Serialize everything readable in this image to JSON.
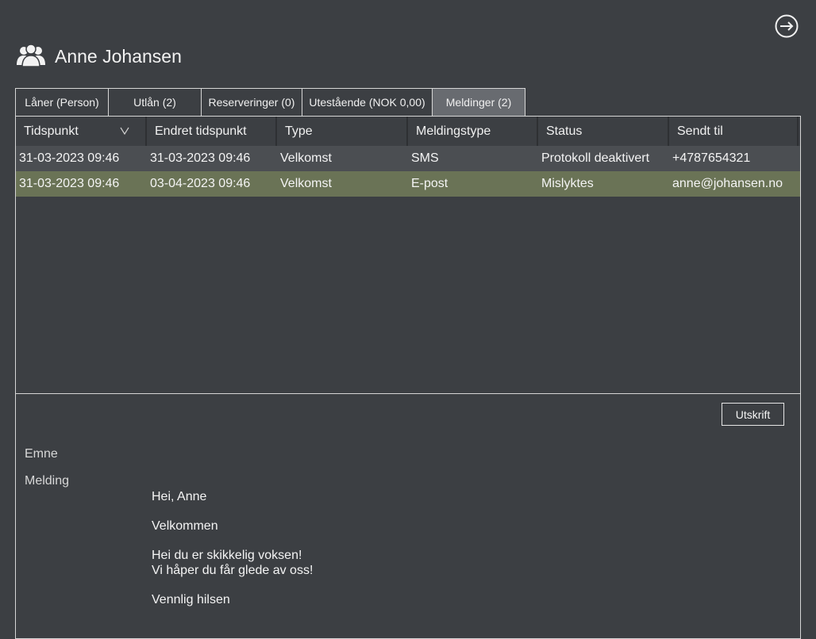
{
  "header": {
    "person_name": "Anne Johansen",
    "icon": "people-icon",
    "logout_icon": "arrow-right-circle-icon"
  },
  "tabs": [
    {
      "label": "Låner (Person)"
    },
    {
      "label": "Utlån (2)"
    },
    {
      "label": "Reserveringer (0)"
    },
    {
      "label": "Utestående (NOK 0,00)"
    },
    {
      "label": "Meldinger (2)",
      "active": true
    }
  ],
  "grid": {
    "columns": [
      {
        "label": "Tidspunkt",
        "sorted": "descending"
      },
      {
        "label": "Endret tidspunkt"
      },
      {
        "label": "Type"
      },
      {
        "label": "Meldingstype"
      },
      {
        "label": "Status"
      },
      {
        "label": "Sendt til"
      }
    ],
    "rows": [
      {
        "cells": [
          "31-03-2023 09:46",
          "31-03-2023 09:46",
          "Velkomst",
          "SMS",
          "Protokoll deaktivert",
          "+4787654321"
        ]
      },
      {
        "cells": [
          "31-03-2023 09:46",
          "03-04-2023 09:46",
          "Velkomst",
          "E-post",
          "Mislyktes",
          "anne@johansen.no"
        ],
        "selected": true
      }
    ]
  },
  "detail": {
    "print_label": "Utskrift",
    "subject_label": "Emne",
    "message_label": "Melding",
    "message_lines": {
      "greeting": "Hei, Anne",
      "welcome": "Velkommen",
      "line1": "Hei du er skikkelig voksen!",
      "line2": "Vi håper du får glede av oss!",
      "closing": "Vennlig hilsen"
    }
  },
  "colors": {
    "background": "#3c3f43",
    "active_tab": "#686b70",
    "selected_row": "#6a7356",
    "alt_row": "#4b4e52"
  }
}
